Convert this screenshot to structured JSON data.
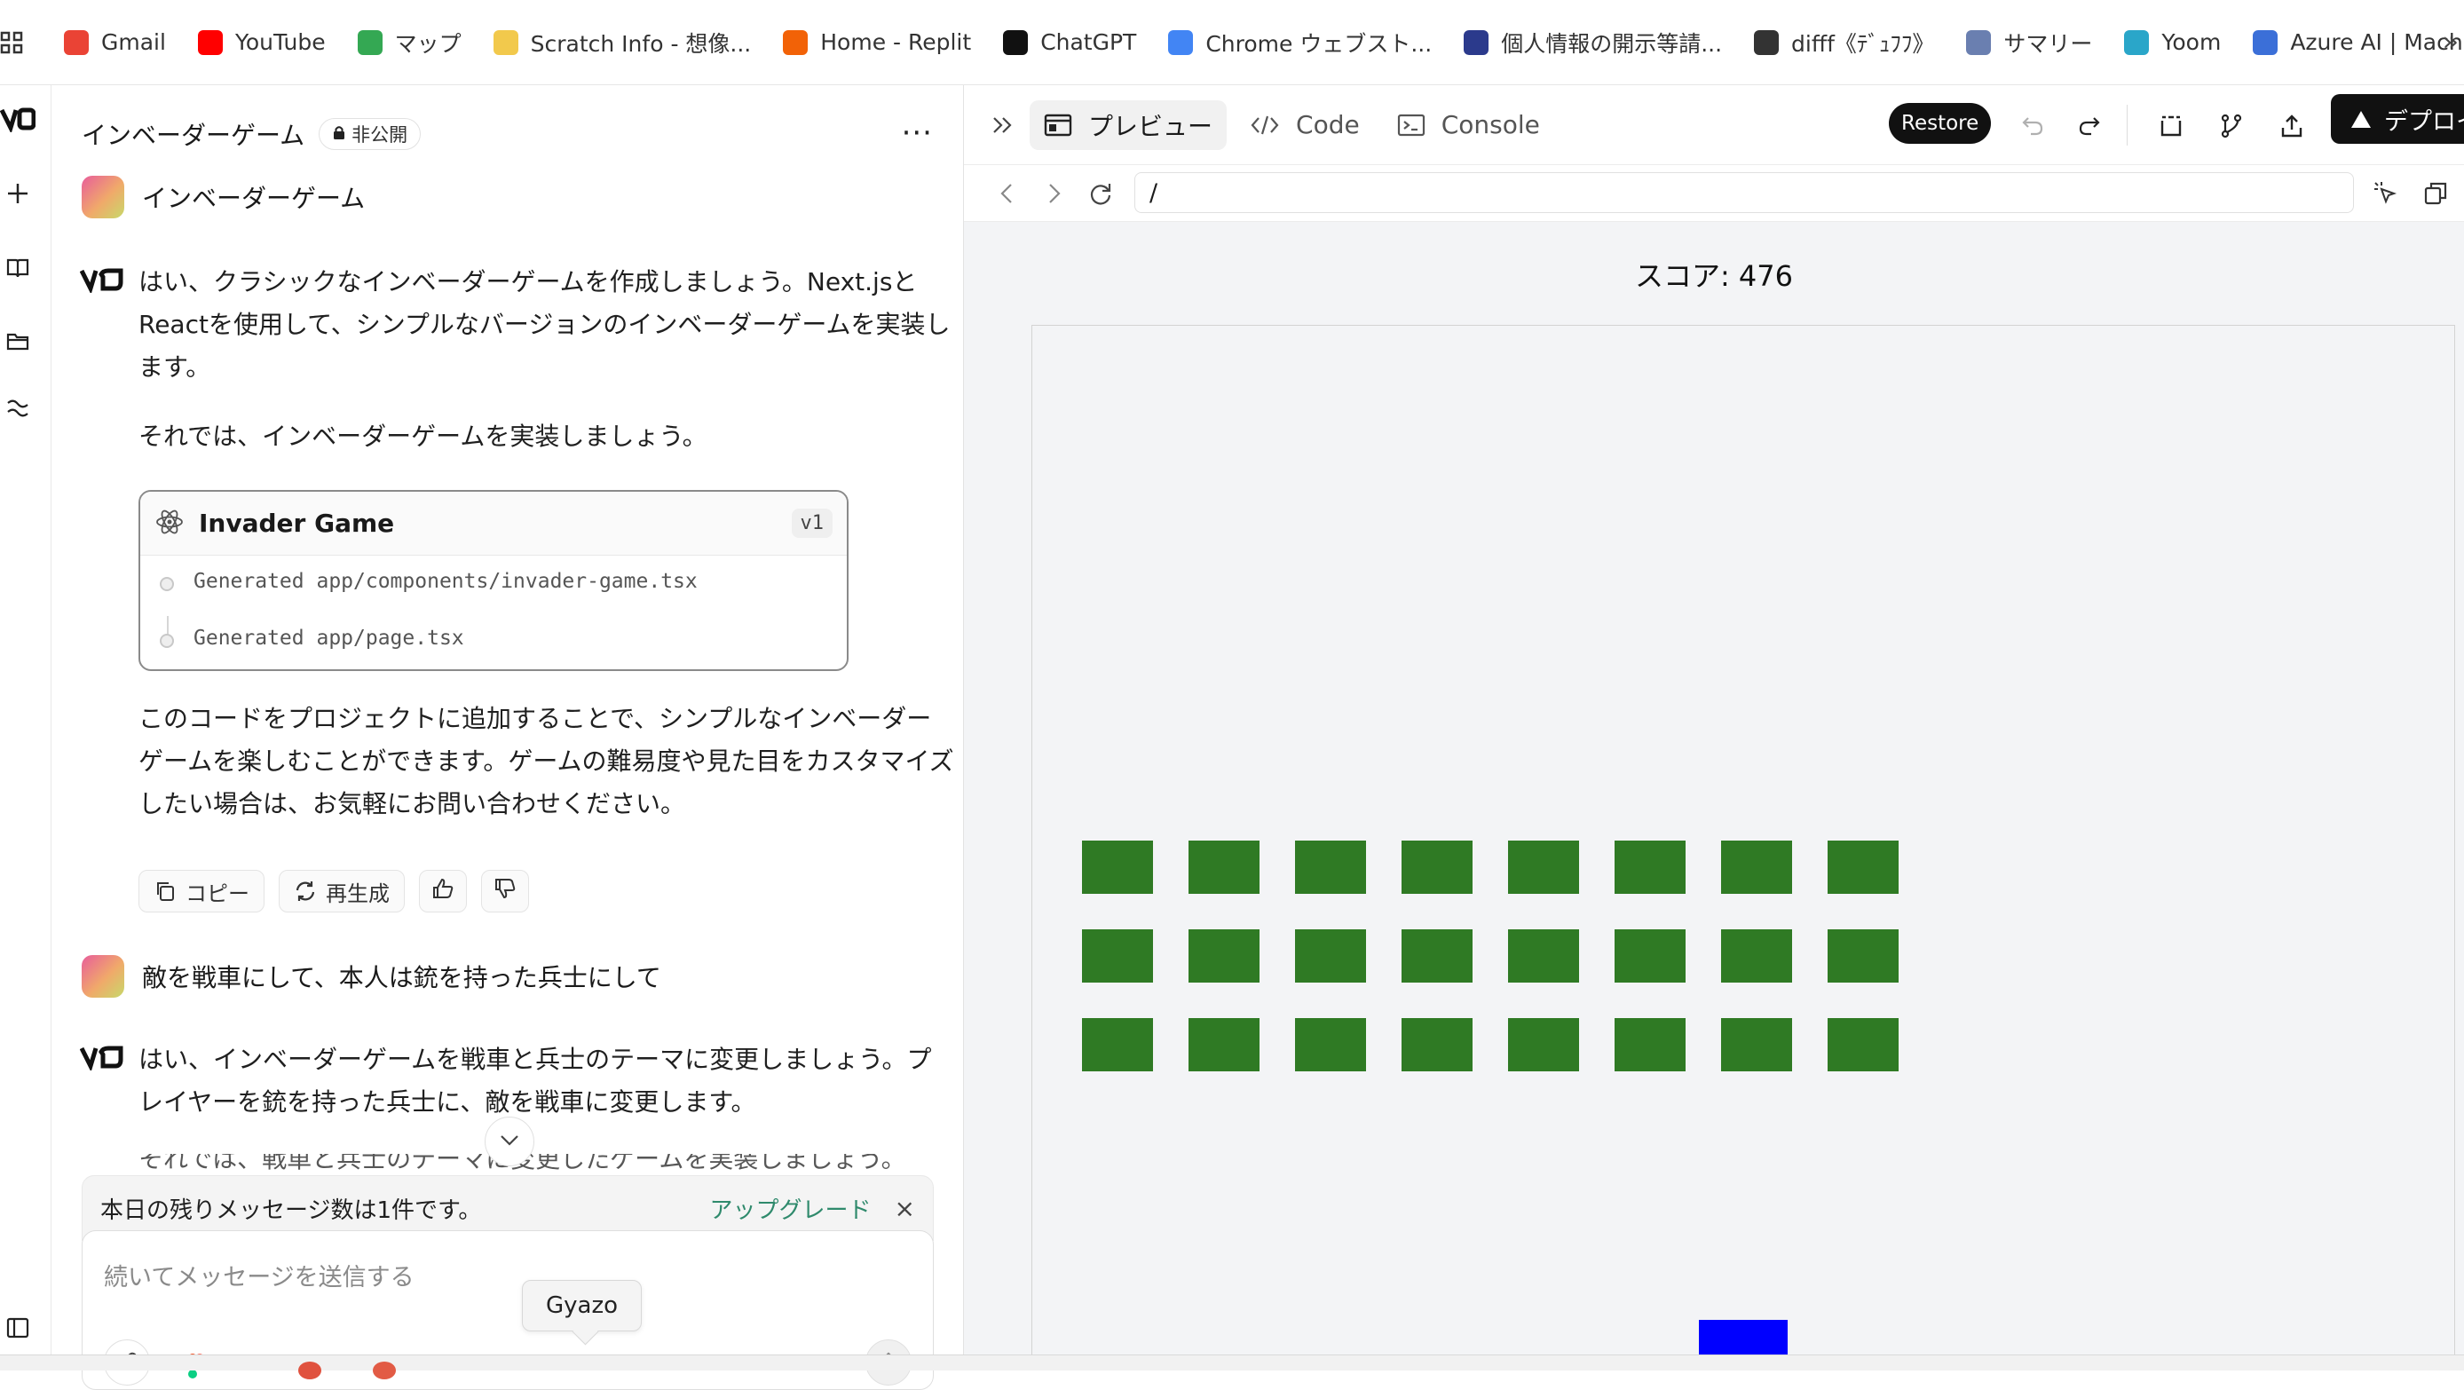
{
  "bookmarks": [
    {
      "label": "Gmail",
      "icon": "gmail-icon",
      "color": "#ea4335"
    },
    {
      "label": "YouTube",
      "icon": "youtube-icon",
      "color": "#ff0000"
    },
    {
      "label": "マップ",
      "icon": "maps-icon",
      "color": "#34a853"
    },
    {
      "label": "Scratch Info - 想像...",
      "icon": "scratch-icon",
      "color": "#f2c94c"
    },
    {
      "label": "Home - Replit",
      "icon": "replit-icon",
      "color": "#f26207"
    },
    {
      "label": "ChatGPT",
      "icon": "chatgpt-icon",
      "color": "#111111"
    },
    {
      "label": "Chrome ウェブスト...",
      "icon": "chrome-store-icon",
      "color": "#4285f4"
    },
    {
      "label": "個人情報の開示等請...",
      "icon": "privacy-icon",
      "color": "#2b3a8c"
    },
    {
      "label": "difff《ﾃﾞｭﾌﾌ》",
      "icon": "difff-icon",
      "color": "#333333"
    },
    {
      "label": "サマリー",
      "icon": "summary-icon",
      "color": "#6a7fb0"
    },
    {
      "label": "Yoom",
      "icon": "yoom-icon",
      "color": "#2aa6c9"
    },
    {
      "label": "Azure AI | Machine...",
      "icon": "azure-icon",
      "color": "#3b6fd8"
    }
  ],
  "chat": {
    "title": "インベーダーゲーム",
    "visibility": "非公開",
    "messages": {
      "user1": "インベーダーゲーム",
      "bot1_p1": "はい、クラシックなインベーダーゲームを作成しましょう。Next.jsとReactを使用して、シンプルなバージョンのインベーダーゲームを実装します。",
      "bot1_p2": "それでは、インベーダーゲームを実装しましょう。",
      "bot1_p3": "このコードをプロジェクトに追加することで、シンプルなインベーダーゲームを楽しむことができます。ゲームの難易度や見た目をカスタマイズしたい場合は、お気軽にお問い合わせください。",
      "user2": "敵を戦車にして、本人は銃を持った兵士にして",
      "bot2_p1": "はい、インベーダーゲームを戦車と兵士のテーマに変更しましょう。プレイヤーを銃を持った兵士に、敵を戦車に変更します。",
      "bot2_p2_partial": "それでは、戦車と兵士のテーマに変更したゲームを実装しましょう。"
    },
    "card": {
      "title": "Invader Game",
      "version": "v1",
      "lines": [
        "Generated app/components/invader-game.tsx",
        "Generated app/page.tsx"
      ]
    },
    "actions": {
      "copy": "コピー",
      "regenerate": "再生成"
    },
    "limit": {
      "text": "本日の残りメッセージ数は1件です。",
      "upgrade": "アップグレード",
      "close": "×"
    },
    "composer": {
      "placeholder": "続いてメッセージを送信する"
    },
    "tooltip": "Gyazo"
  },
  "toolbar": {
    "tabs": [
      {
        "label": "プレビュー",
        "icon": "preview-icon",
        "active": true
      },
      {
        "label": "Code",
        "icon": "code-icon",
        "active": false
      },
      {
        "label": "Console",
        "icon": "console-icon",
        "active": false
      }
    ],
    "restore": "Restore",
    "deploy": "デプロイ"
  },
  "urlbar": {
    "path": "/"
  },
  "game": {
    "score_text": "スコア: 476",
    "invader_rows": 3,
    "invader_cols": 8,
    "invader_color": "#2f7a24",
    "player_color": "#0000ff",
    "background": "#f3f4f6"
  }
}
